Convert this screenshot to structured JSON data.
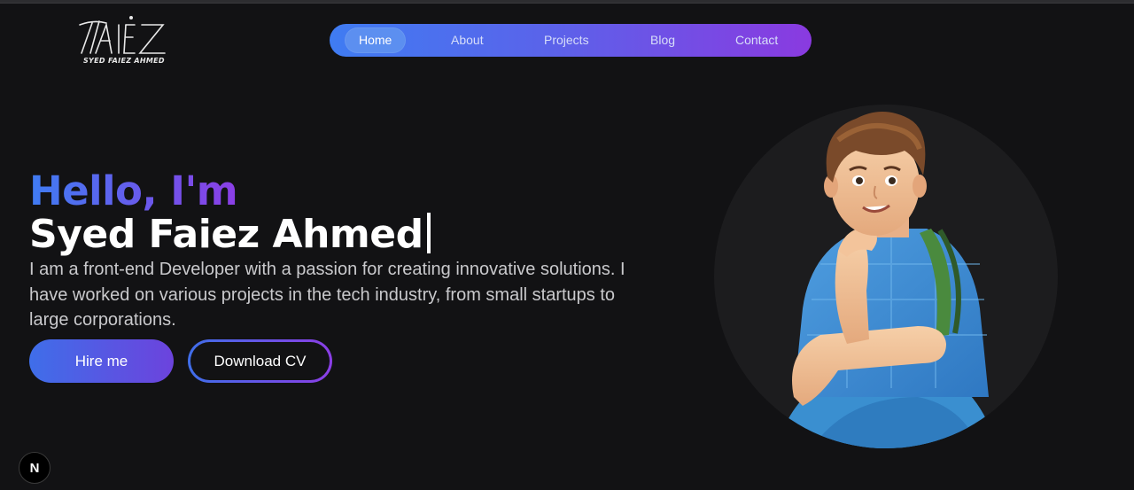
{
  "logo": {
    "monogram": "FAIEZ",
    "subtitle": "SYED FAIEZ AHMED"
  },
  "nav": {
    "items": [
      {
        "label": "Home",
        "active": true
      },
      {
        "label": "About",
        "active": false
      },
      {
        "label": "Projects",
        "active": false
      },
      {
        "label": "Blog",
        "active": false
      },
      {
        "label": "Contact",
        "active": false
      }
    ]
  },
  "hero": {
    "greeting": "Hello, I'm",
    "name": "Syed Faiez Ahmed",
    "bio": "I am a front-end Developer with a passion for creating innovative solutions. I have worked on various projects in the tech industry, from small startups to large corporations.",
    "hire_label": "Hire me",
    "cv_label": "Download CV"
  },
  "badge": {
    "label": "N"
  },
  "colors": {
    "background": "#121214",
    "gradient_start": "#3f7cf2",
    "gradient_end": "#8b3ee6"
  }
}
